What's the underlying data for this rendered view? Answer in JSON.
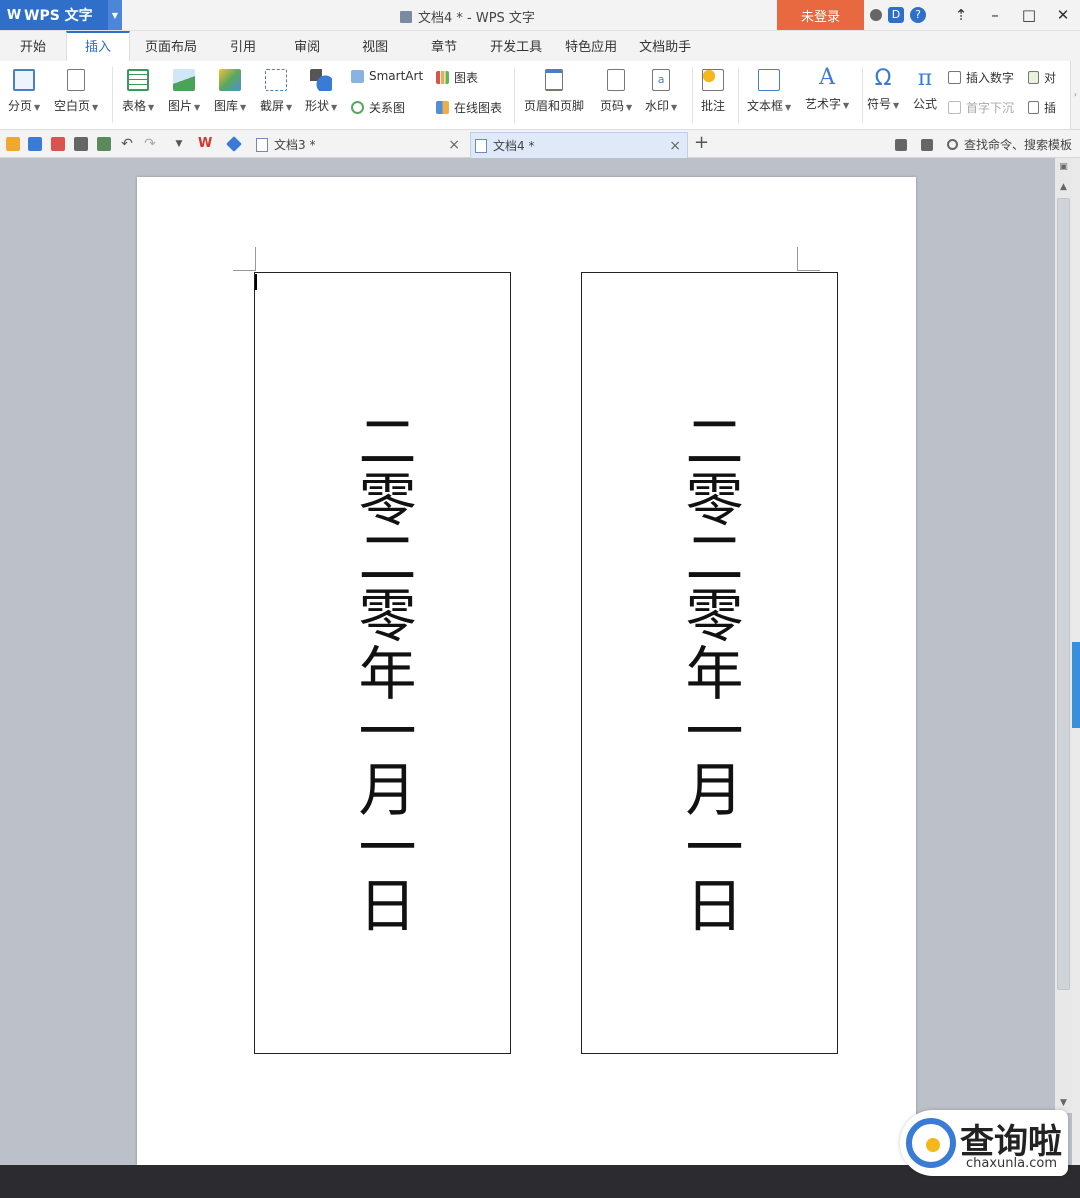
{
  "app": {
    "logo": "WPS 文字",
    "window_title": "文档4 * - WPS 文字",
    "login_label": "未登录"
  },
  "menu": {
    "tabs": [
      {
        "label": "开始"
      },
      {
        "label": "插入"
      },
      {
        "label": "页面布局"
      },
      {
        "label": "引用"
      },
      {
        "label": "审阅"
      },
      {
        "label": "视图"
      },
      {
        "label": "章节"
      },
      {
        "label": "开发工具"
      },
      {
        "label": "特色应用"
      },
      {
        "label": "文档助手"
      }
    ],
    "active_tab": "插入"
  },
  "ribbon": {
    "page_break": "分页",
    "blank_page": "空白页",
    "table": "表格",
    "picture": "图片",
    "gallery": "图库",
    "screenshot": "截屏",
    "shape": "形状",
    "smartart": "SmartArt",
    "chart": "图表",
    "relation_chart": "关系图",
    "online_chart": "在线图表",
    "header_footer": "页眉和页脚",
    "page_number": "页码",
    "watermark": "水印",
    "comment": "批注",
    "textbox": "文本框",
    "wordart": "艺术字",
    "symbol": "符号",
    "formula": "公式",
    "insert_number": "插入数字",
    "object": "对",
    "drop_cap": "首字下沉",
    "insert": "插"
  },
  "doc_tabs": [
    {
      "label": "文档3 *"
    },
    {
      "label": "文档4 *"
    }
  ],
  "search_label": "查找命令、搜索模板",
  "document": {
    "textbox_left": "二零二零年一月一日",
    "textbox_right": "二零二零年一月一日"
  },
  "watermark": {
    "cn": "查询啦",
    "en": "chaxunla.com"
  },
  "colors": {
    "brand_blue": "#2f6fc9",
    "login_orange": "#e8683f"
  }
}
